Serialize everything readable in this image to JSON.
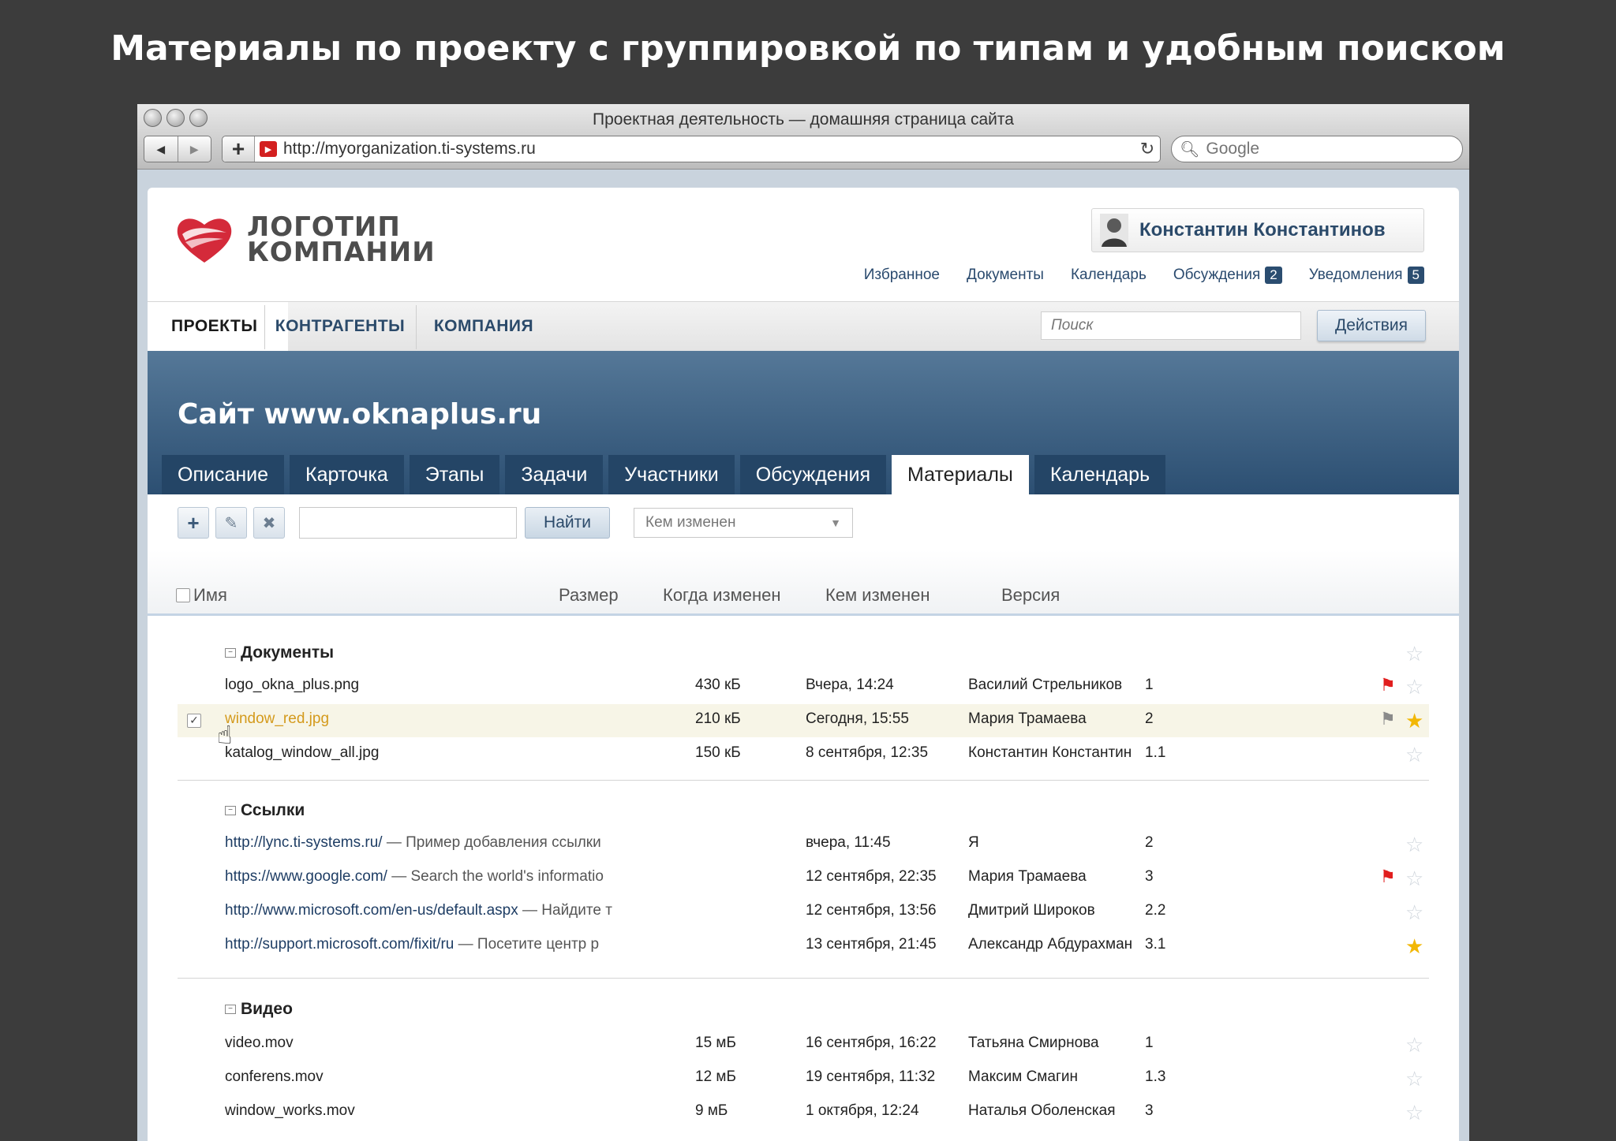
{
  "slide_title": "Материалы по проекту с группировкой по типам и удобным поиском",
  "browser": {
    "window_title": "Проектная деятельность — домашняя страница сайта",
    "url": "http://myorganization.ti-systems.ru",
    "search_placeholder": "Google"
  },
  "header": {
    "logo_line1": "ЛОГОТИП",
    "logo_line2": "КОМПАНИИ",
    "user_name": "Константин Константинов",
    "links": [
      {
        "label": "Избранное"
      },
      {
        "label": "Документы"
      },
      {
        "label": "Календарь"
      },
      {
        "label": "Обсуждения",
        "badge": "2"
      },
      {
        "label": "Уведомления",
        "badge": "5"
      }
    ]
  },
  "main_nav": {
    "tabs": [
      "ПРОЕКТЫ",
      "КОНТРАГЕНТЫ",
      "КОМПАНИЯ"
    ],
    "search_placeholder": "Поиск",
    "actions_label": "Действия"
  },
  "project": {
    "title": "Сайт www.oknaplus.ru",
    "tabs": [
      "Описание",
      "Карточка",
      "Этапы",
      "Задачи",
      "Участники",
      "Обсуждения",
      "Материалы",
      "Календарь"
    ],
    "active_tab": "Материалы"
  },
  "toolbar": {
    "find_label": "Найти",
    "changed_by_placeholder": "Кем изменен"
  },
  "table": {
    "columns": [
      "Имя",
      "Размер",
      "Когда изменен",
      "Кем изменен",
      "Версия"
    ],
    "groups": [
      {
        "title": "Документы",
        "rows": [
          {
            "name": "logo_okna_plus.png",
            "size": "430 кБ",
            "date": "Вчера, 14:24",
            "who": "Василий Стрельников",
            "ver": "1",
            "flag": "red",
            "starred": false
          },
          {
            "name": "window_red.jpg",
            "size": "210 кБ",
            "date": "Сегодня, 15:55",
            "who": "Мария Трамаева",
            "ver": "2",
            "flag": "grey",
            "starred": true,
            "selected": true
          },
          {
            "name": "katalog_window_all.jpg",
            "size": "150 кБ",
            "date": "8 сентября, 12:35",
            "who": "Константин Константин",
            "ver": "1.1",
            "flag": "",
            "starred": false
          }
        ]
      },
      {
        "title": "Ссылки",
        "rows": [
          {
            "url": "http://lync.ti-systems.ru/",
            "desc": " — Пример добавления ссылки",
            "date": "вчера, 11:45",
            "who": "Я",
            "ver": "2",
            "flag": "",
            "starred": false
          },
          {
            "url": "https://www.google.com/",
            "desc": " — Search the world's informatio",
            "date": "12 сентября, 22:35",
            "who": "Мария Трамаева",
            "ver": "3",
            "flag": "red",
            "starred": false
          },
          {
            "url": "http://www.microsoft.com/en-us/default.aspx",
            "desc": " — Найдите т",
            "date": "12 сентября, 13:56",
            "who": "Дмитрий Широков",
            "ver": "2.2",
            "flag": "",
            "starred": false
          },
          {
            "url": "http://support.microsoft.com/fixit/ru",
            "desc": " — Посетите центр р",
            "date": "13 сентября, 21:45",
            "who": "Александр Абдурахман",
            "ver": "3.1",
            "flag": "",
            "starred": true
          }
        ]
      },
      {
        "title": "Видео",
        "rows": [
          {
            "name": "video.mov",
            "size": "15 мБ",
            "date": "16 сентября, 16:22",
            "who": "Татьяна  Смирнова",
            "ver": "1",
            "flag": "",
            "starred": false
          },
          {
            "name": "conferens.mov",
            "size": "12 мБ",
            "date": "19 сентября, 11:32",
            "who": "Максим Смагин",
            "ver": "1.3",
            "flag": "",
            "starred": false
          },
          {
            "name": "window_works.mov",
            "size": "9 мБ",
            "date": "1 октября, 12:24",
            "who": "Наталья Оболенская",
            "ver": "3",
            "flag": "",
            "starred": false
          }
        ]
      }
    ]
  },
  "colors": {
    "brand_red": "#d42a3a",
    "nav_blue": "#2b4a6a",
    "selected_row_name": "#d49a1c",
    "star_on": "#f2b705",
    "flag_red": "#e11e1e"
  }
}
